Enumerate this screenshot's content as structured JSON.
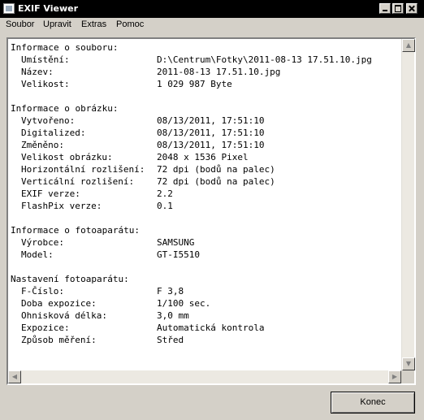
{
  "window": {
    "title": "EXIF Viewer"
  },
  "menu": [
    "Soubor",
    "Upravit",
    "Extras",
    "Pomoc"
  ],
  "sections": [
    {
      "heading": "Informace o souboru:",
      "rows": [
        {
          "label": "Umístění:",
          "value": "D:\\Centrum\\Fotky\\2011-08-13 17.51.10.jpg"
        },
        {
          "label": "Název:",
          "value": "2011-08-13 17.51.10.jpg"
        },
        {
          "label": "Velikost:",
          "value": "1 029 987 Byte"
        }
      ]
    },
    {
      "heading": "Informace o obrázku:",
      "rows": [
        {
          "label": "Vytvořeno:",
          "value": "08/13/2011, 17:51:10"
        },
        {
          "label": "Digitalized:",
          "value": "08/13/2011, 17:51:10"
        },
        {
          "label": "Změněno:",
          "value": "08/13/2011, 17:51:10"
        },
        {
          "label": "Velikost obrázku:",
          "value": "2048 x 1536 Pixel"
        },
        {
          "label": "Horizontální rozlišení:",
          "value": "72 dpi (bodů na palec)"
        },
        {
          "label": "Verticální rozlišení:",
          "value": "72 dpi (bodů na palec)"
        },
        {
          "label": "EXIF verze:",
          "value": "2.2"
        },
        {
          "label": "FlashPix verze:",
          "value": "0.1"
        }
      ]
    },
    {
      "heading": "Informace o fotoaparátu:",
      "rows": [
        {
          "label": "Výrobce:",
          "value": "SAMSUNG"
        },
        {
          "label": "Model:",
          "value": "GT-I5510"
        }
      ]
    },
    {
      "heading": "Nastavení fotoaparátu:",
      "rows": [
        {
          "label": "F-Číslo:",
          "value": "F 3,8"
        },
        {
          "label": "Doba expozice:",
          "value": "1/100 sec."
        },
        {
          "label": "Ohnisková délka:",
          "value": "3,0 mm"
        },
        {
          "label": "Expozice:",
          "value": "Automatická kontrola"
        },
        {
          "label": "Způsob měření:",
          "value": "Střed"
        }
      ]
    }
  ],
  "buttons": {
    "close": "Konec"
  }
}
